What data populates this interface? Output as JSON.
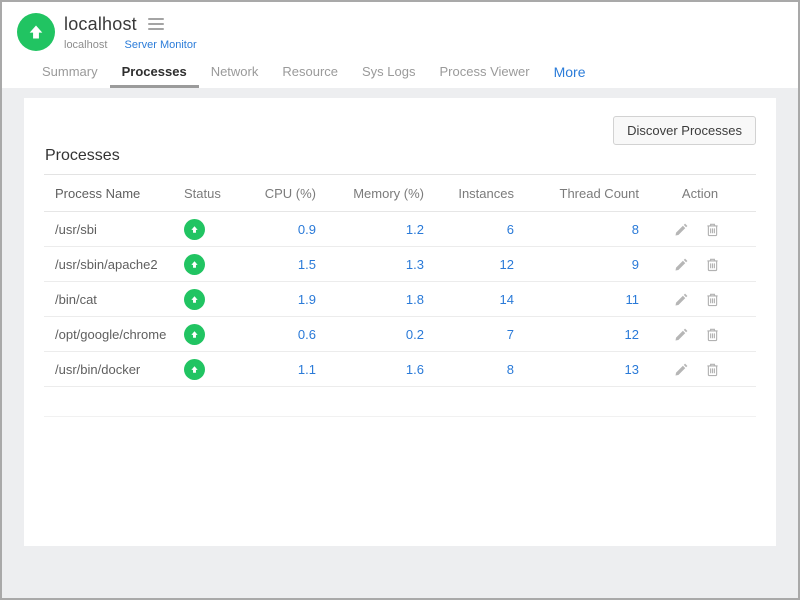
{
  "header": {
    "title": "localhost",
    "subtitle": "localhost",
    "subtitle_link": "Server Monitor"
  },
  "tabs": [
    {
      "label": "Summary",
      "active": false
    },
    {
      "label": "Processes",
      "active": true
    },
    {
      "label": "Network",
      "active": false
    },
    {
      "label": "Resource",
      "active": false
    },
    {
      "label": "Sys Logs",
      "active": false
    },
    {
      "label": "Process Viewer",
      "active": false
    },
    {
      "label": "More",
      "active": false,
      "highlighted": true
    }
  ],
  "main": {
    "discover_button_label": "Discover Processes",
    "section_title": "Processes",
    "table": {
      "columns": [
        "Process Name",
        "Status",
        "CPU (%)",
        "Memory (%)",
        "Instances",
        "Thread Count",
        "Action"
      ],
      "rows": [
        {
          "name": "/usr/sbi",
          "status": "up",
          "cpu": "0.9",
          "memory": "1.2",
          "instances": "6",
          "threads": "8"
        },
        {
          "name": "/usr/sbin/apache2",
          "status": "up",
          "cpu": "1.5",
          "memory": "1.3",
          "instances": "12",
          "threads": "9"
        },
        {
          "name": "/bin/cat",
          "status": "up",
          "cpu": "1.9",
          "memory": "1.8",
          "instances": "14",
          "threads": "11"
        },
        {
          "name": "/opt/google/chrome",
          "status": "up",
          "cpu": "0.6",
          "memory": "0.2",
          "instances": "7",
          "threads": "12"
        },
        {
          "name": "/usr/bin/docker",
          "status": "up",
          "cpu": "1.1",
          "memory": "1.6",
          "instances": "8",
          "threads": "13"
        }
      ]
    }
  },
  "icons": {
    "logo": "up-arrow-circle-icon",
    "menu": "hamburger-icon",
    "status": "up-arrow-circle-icon",
    "edit": "pencil-icon",
    "delete": "trash-icon"
  },
  "colors": {
    "status_green": "#21c462",
    "link_blue": "#2b7cd9",
    "value_blue": "#2a7ad8",
    "page_background": "#edeef0",
    "frame_border": "#a9a9a9"
  }
}
